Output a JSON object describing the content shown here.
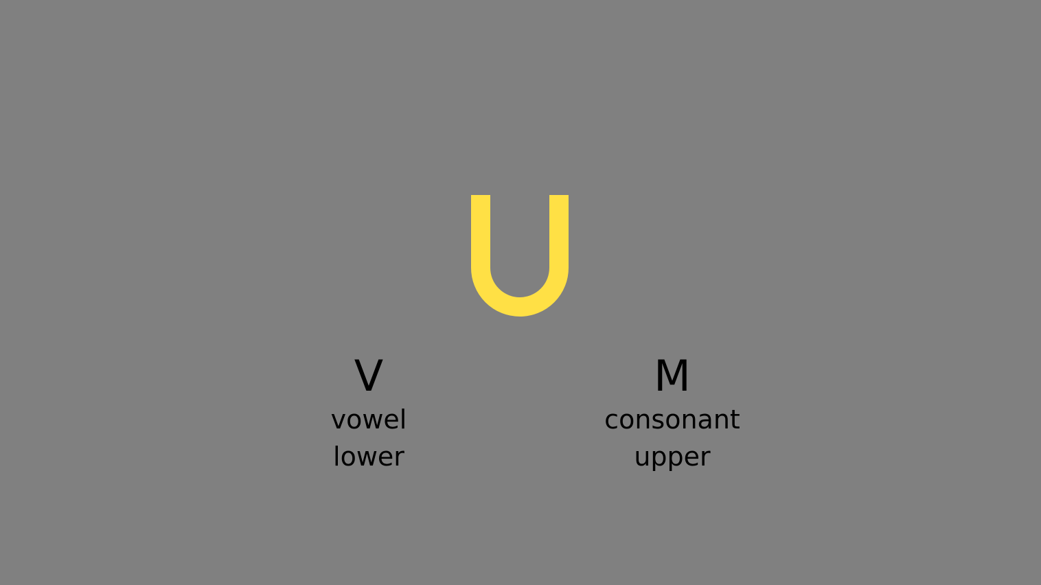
{
  "stimulus": {
    "letter": "U",
    "color": "#FFE045"
  },
  "background_color": "#808080",
  "choices": {
    "left": {
      "key": "V",
      "line1": "vowel",
      "line2": "lower"
    },
    "right": {
      "key": "M",
      "line1": "consonant",
      "line2": "upper"
    }
  }
}
